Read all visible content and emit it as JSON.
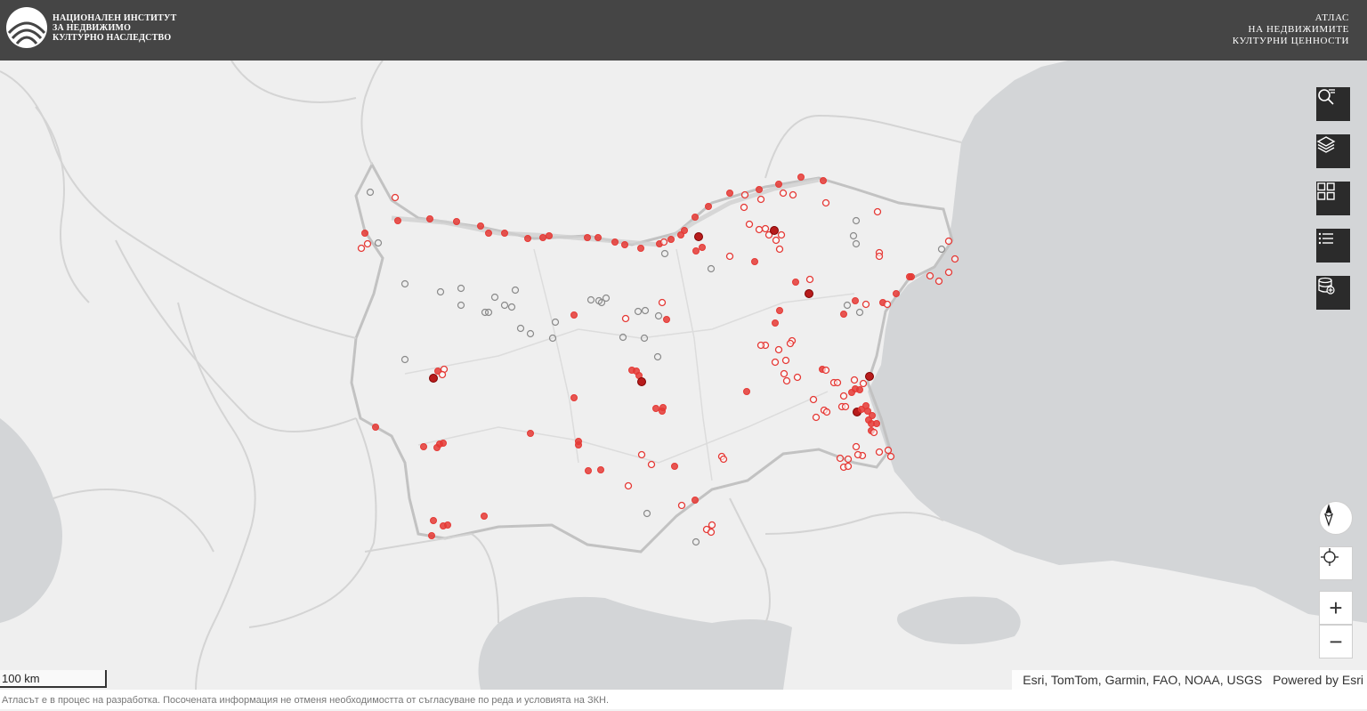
{
  "header": {
    "institute_lines": [
      "НАЦИОНАЛЕН ИНСТИТУТ",
      "ЗА НЕДВИЖИМО",
      "КУЛТУРНО НАСЛЕДСТВО"
    ],
    "atlas_lines": [
      "АТЛАС",
      "НА НЕДВИЖИМИТЕ",
      "КУЛТУРНИ ЦЕННОСТИ"
    ]
  },
  "toolbar": {
    "items": [
      {
        "name": "search-tool-button",
        "icon": "search-list-icon"
      },
      {
        "name": "layers-button",
        "icon": "layers-icon"
      },
      {
        "name": "basemap-gallery-button",
        "icon": "grid-icon"
      },
      {
        "name": "legend-button",
        "icon": "list-icon"
      },
      {
        "name": "data-add-button",
        "icon": "database-add-icon"
      }
    ]
  },
  "navigation": {
    "compass": "compass-icon",
    "locate": "crosshair-icon",
    "zoom_in": "+",
    "zoom_out": "−"
  },
  "map": {
    "scale_label": "100 km",
    "attribution": "Esri, TomTom, Garmin, FAO, NOAA, USGS",
    "powered_by": "Powered by Esri",
    "colors": {
      "marker_red": "#e53935",
      "marker_dark_red": "#b71c1c",
      "marker_gray": "#8a8a8a",
      "sea": "#d3d5d7",
      "land": "#efefef"
    }
  },
  "footer": {
    "notice": "Атласът е в процес на разработка. Посочената информация не отменя необходимостта от съгласуване по реда и условията на ЗКН."
  }
}
